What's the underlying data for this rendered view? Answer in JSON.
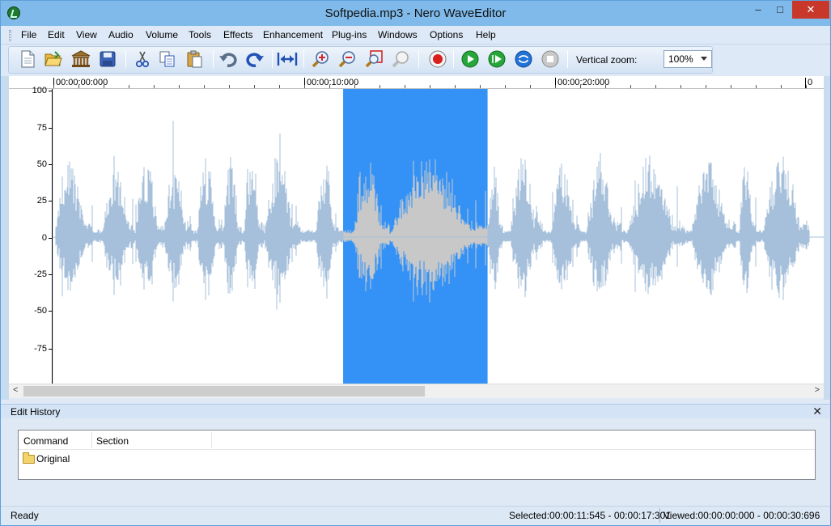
{
  "window": {
    "title": "Softpedia.mp3 - Nero WaveEditor",
    "minimize": "–",
    "maximize": "□",
    "close": "✕"
  },
  "menu": [
    "File",
    "Edit",
    "View",
    "Audio",
    "Volume",
    "Tools",
    "Effects",
    "Enhancement",
    "Plug-ins",
    "Windows",
    "Options",
    "Help"
  ],
  "toolbar": {
    "icons": [
      "new-file-icon",
      "open-folder-icon",
      "library-icon",
      "save-icon",
      "cut-icon",
      "copy-icon",
      "paste-icon",
      "undo-icon",
      "redo-icon",
      "fit-width-icon",
      "zoom-in-icon",
      "zoom-out-icon",
      "zoom-selection-icon",
      "zoom-reset-icon",
      "record-icon",
      "play-icon",
      "play-selection-icon",
      "loop-icon",
      "stop-icon"
    ],
    "vertical_zoom_label": "Vertical zoom:",
    "vertical_zoom_value": "100%"
  },
  "ruler": {
    "labels": [
      "00:00:00:000",
      "00:00:10:000",
      "00:00:20:000",
      "0"
    ]
  },
  "yaxis": {
    "labels": [
      "100",
      "75",
      "50",
      "25",
      "0",
      "-25",
      "-50",
      "-75"
    ]
  },
  "waveform": {
    "view_start_s": 0,
    "view_end_s": 30.696,
    "selection_start_s": 11.545,
    "selection_end_s": 17.301,
    "colors": {
      "wave": "#a6bfda",
      "wave_selected": "#c8c8c8",
      "selection": "#3492f6",
      "background": "#ffffff"
    }
  },
  "edit_history": {
    "title": "Edit History",
    "close": "✕",
    "columns": [
      "Command",
      "Section"
    ],
    "rows": [
      {
        "command": "Original",
        "section": ""
      }
    ]
  },
  "status": {
    "ready": "Ready",
    "selected": "Selected:00:00:11:545 - 00:00:17:301",
    "viewed": "Viewed:00:00:00:000 - 00:00:30:696"
  }
}
